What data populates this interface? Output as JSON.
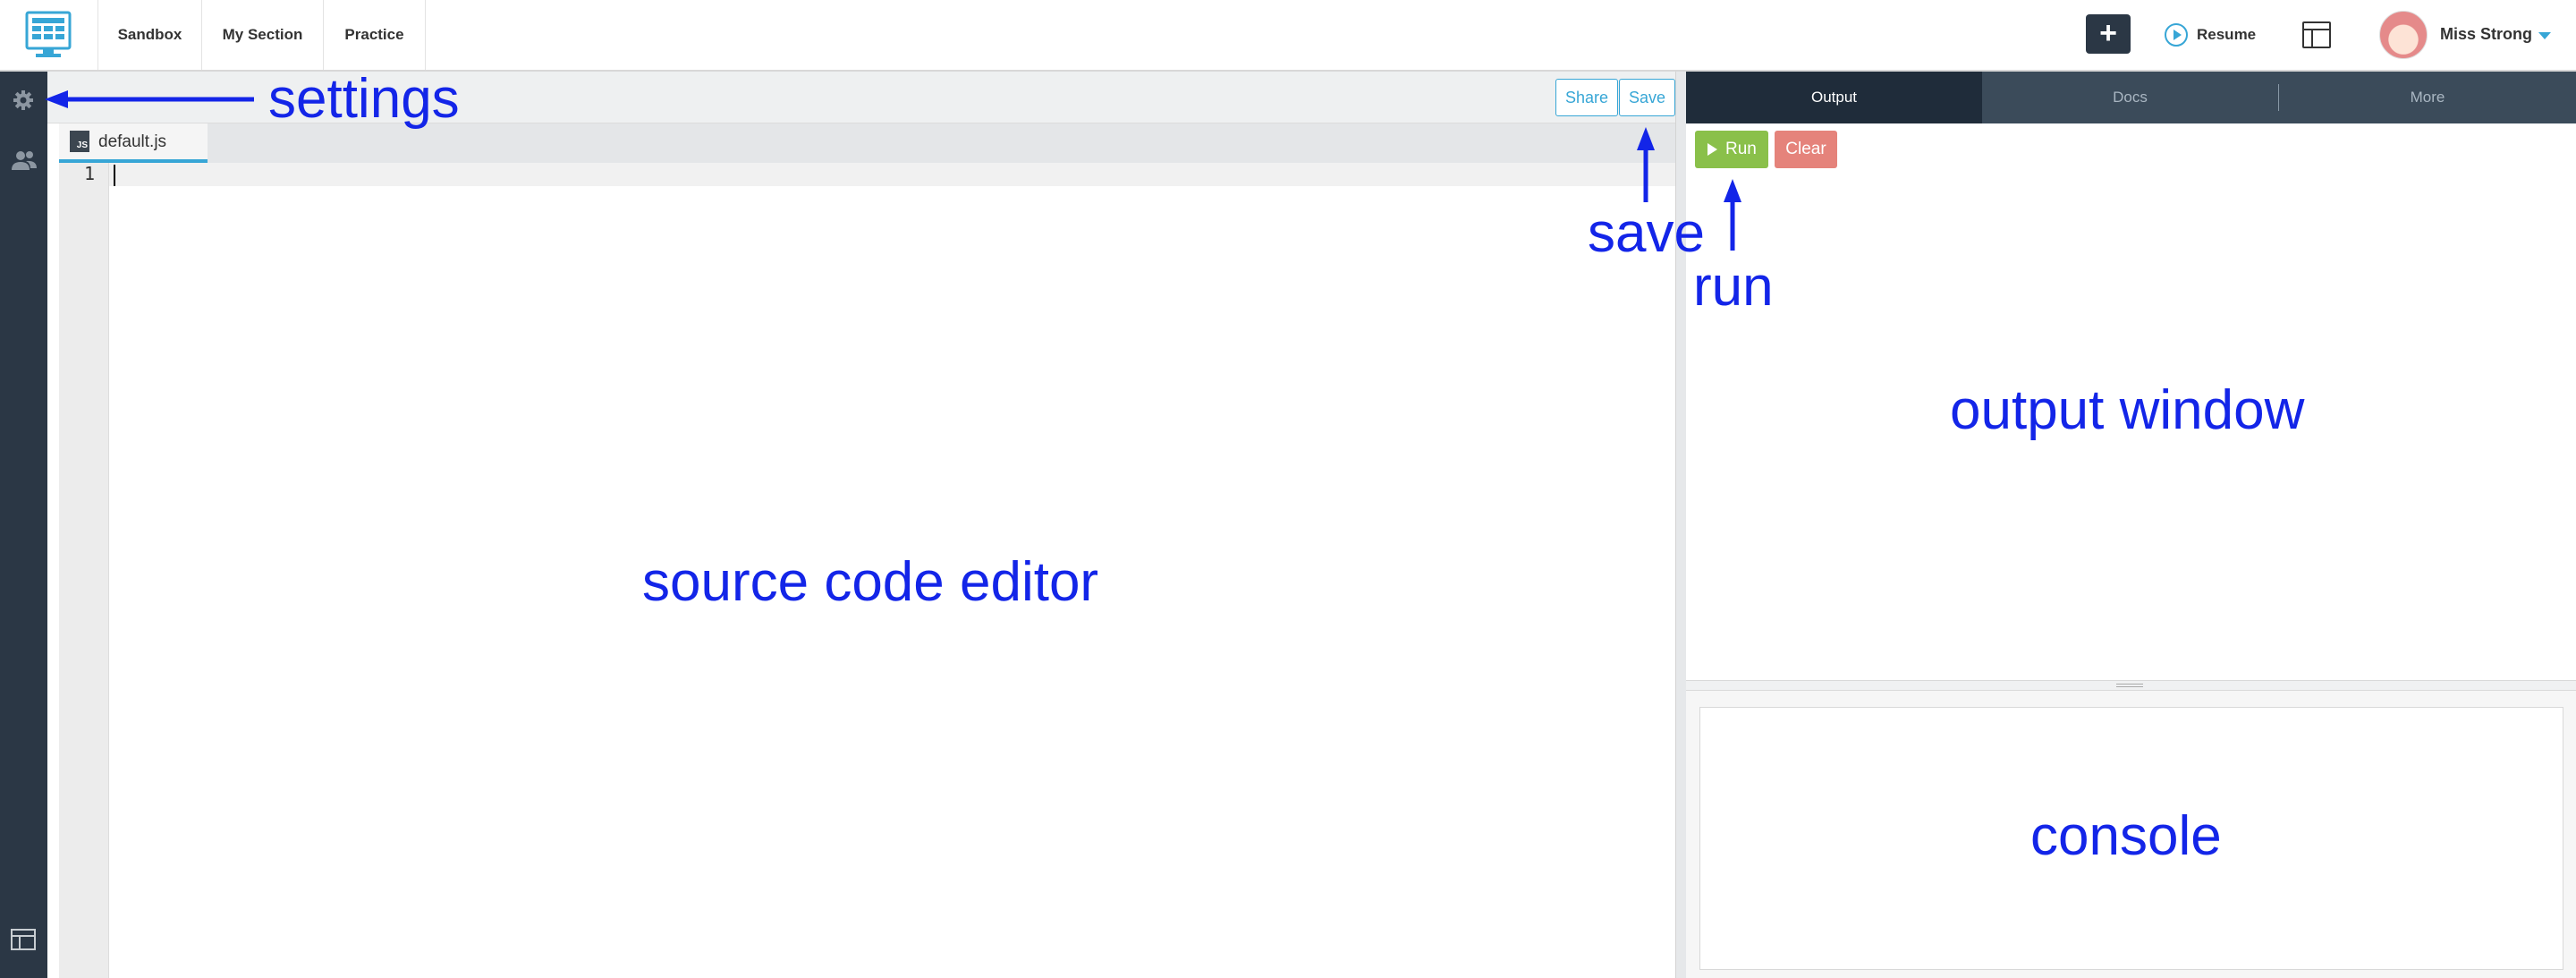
{
  "topnav": {
    "links": [
      "Sandbox",
      "My Section",
      "Practice"
    ],
    "plus_label": "+",
    "resume_label": "Resume",
    "user_name": "Miss Strong"
  },
  "editor": {
    "share_label": "Share",
    "save_label": "Save",
    "file_tab": "default.js",
    "file_icon_text": "JS",
    "line_number": "1"
  },
  "right_panel": {
    "tabs": [
      "Output",
      "Docs",
      "More"
    ],
    "run_label": "Run",
    "clear_label": "Clear"
  },
  "annotations": {
    "settings": "settings",
    "save": "save",
    "run": "run",
    "output": "output window",
    "editor": "source code editor",
    "console": "console"
  },
  "colors": {
    "accent": "#37a6d6",
    "sidebar": "#2b3745",
    "run": "#8ac04a",
    "clear": "#e5837b",
    "annotation": "#1325e8"
  }
}
